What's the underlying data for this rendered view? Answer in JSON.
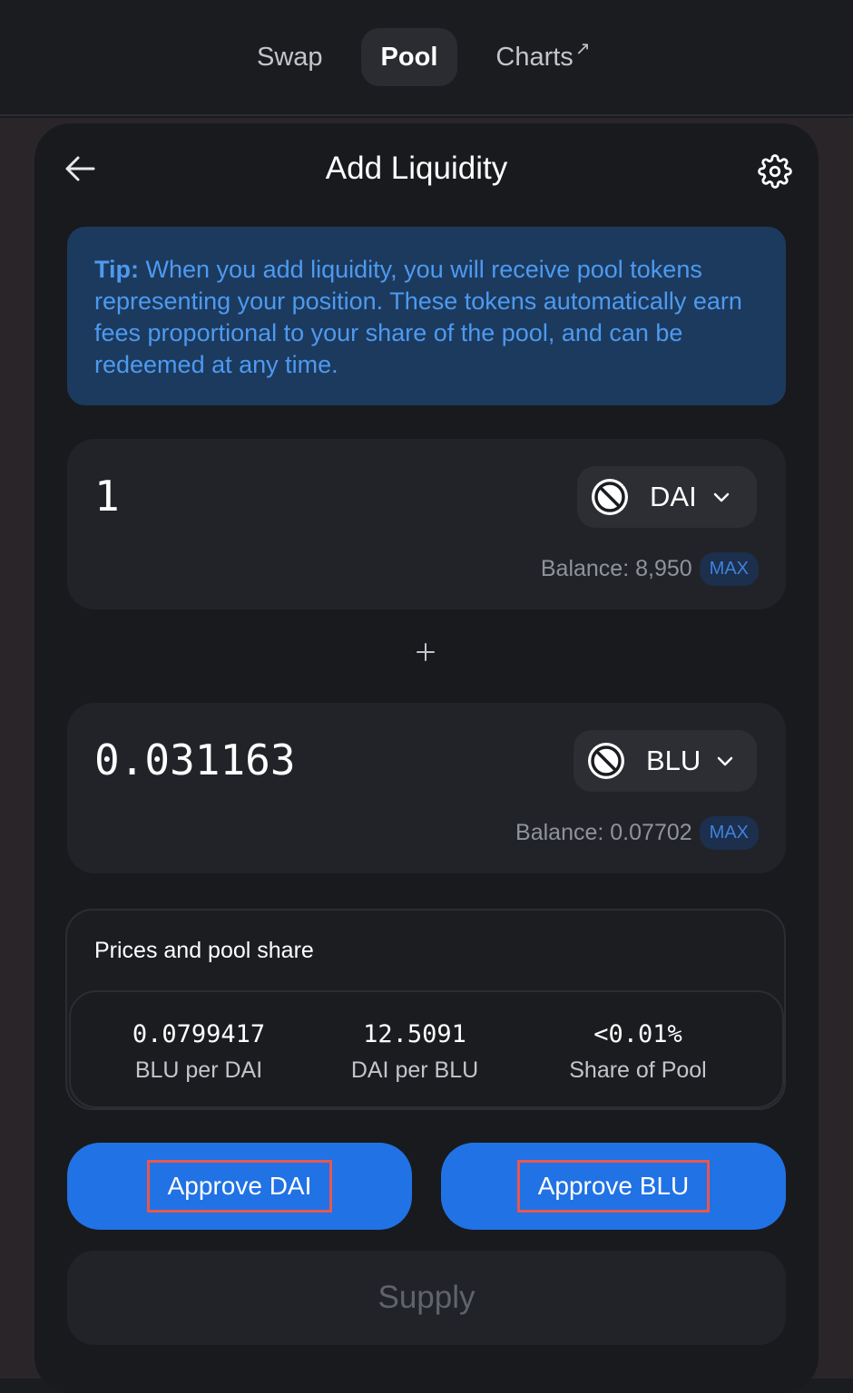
{
  "nav": {
    "swap": "Swap",
    "pool": "Pool",
    "charts": "Charts",
    "charts_ext": "↗"
  },
  "header": {
    "title": "Add Liquidity"
  },
  "tip": {
    "label": "Tip:",
    "text": "When you add liquidity, you will receive pool tokens representing your position. These tokens automatically earn fees proportional to your share of the pool, and can be redeemed at any time."
  },
  "input_a": {
    "amount": "1",
    "token": "DAI",
    "balance": "Balance: 8,950",
    "max": "MAX"
  },
  "plus": "+",
  "input_b": {
    "amount": "0.031163",
    "token": "BLU",
    "balance": "Balance: 0.07702",
    "max": "MAX"
  },
  "prices": {
    "title": "Prices and pool share",
    "items": [
      {
        "value": "0.0799417",
        "label": "BLU per DAI"
      },
      {
        "value": "12.5091",
        "label": "DAI per BLU"
      },
      {
        "value": "<0.01%",
        "label": "Share of Pool"
      }
    ]
  },
  "actions": {
    "approve_a": "Approve DAI",
    "approve_b": "Approve BLU",
    "supply": "Supply"
  },
  "colors": {
    "accent": "#2172e5",
    "tip_bg": "#1c3a5e",
    "tip_text": "#4d9af0",
    "highlight": "#e8574d"
  }
}
